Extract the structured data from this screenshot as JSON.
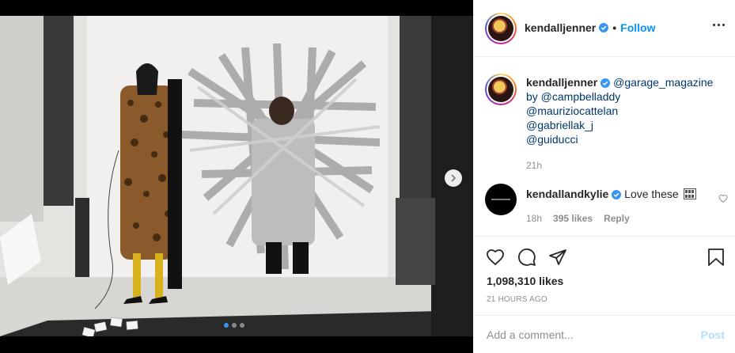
{
  "post": {
    "author": "kendalljenner",
    "follow_label": "Follow",
    "separator": "•",
    "caption_mentions": [
      "@garage_magazine",
      "by @campbelladdy",
      "@mauriziocattelan",
      "@gabriellak_j",
      "@guiducci"
    ],
    "caption_time": "21h",
    "likes_label": "1,098,310 likes",
    "date_label": "21 HOURS AGO"
  },
  "comment": {
    "author": "kendallandkylie",
    "text": "Love these",
    "time": "18h",
    "likes": "395 likes",
    "reply_label": "Reply"
  },
  "composer": {
    "placeholder": "Add a comment...",
    "post_label": "Post"
  },
  "carousel": {
    "slide_count": 3,
    "active_index": 0
  },
  "colors": {
    "link": "#0095f6",
    "verified": "#3897f0",
    "muted": "#8e8e8e",
    "post_disabled": "#b2dffc"
  },
  "icons": {
    "verified": "verified-badge-icon",
    "more": "more-options-icon",
    "like": "heart-icon",
    "comment": "comment-icon",
    "share": "paper-plane-icon",
    "save": "bookmark-icon",
    "next": "chevron-right-icon",
    "gif": "gif-emoji-icon"
  }
}
